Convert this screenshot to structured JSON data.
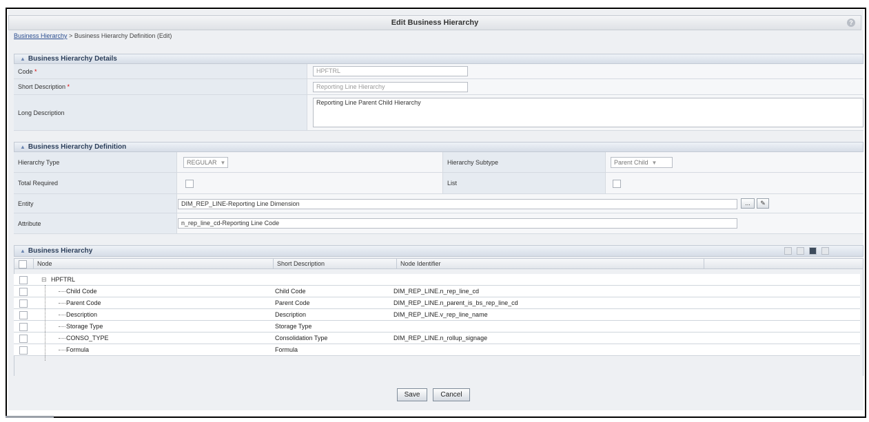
{
  "window": {
    "title": "Edit Business Hierarchy"
  },
  "breadcrumb": {
    "link": "Business Hierarchy",
    "separator": ">",
    "current": "Business Hierarchy Definition (Edit)"
  },
  "details": {
    "header": "Business Hierarchy Details",
    "code_label": "Code",
    "code_value": "HPFTRL",
    "short_desc_label": "Short Description",
    "short_desc_value": "Reporting Line Hierarchy",
    "long_desc_label": "Long Description",
    "long_desc_value": "Reporting Line Parent Child Hierarchy",
    "required_marker": "*"
  },
  "definition": {
    "header": "Business Hierarchy Definition",
    "hierarchy_type_label": "Hierarchy Type",
    "hierarchy_type_value": "REGULAR",
    "hierarchy_subtype_label": "Hierarchy Subtype",
    "hierarchy_subtype_value": "Parent Child",
    "total_required_label": "Total Required",
    "list_label": "List",
    "entity_label": "Entity",
    "entity_value": "DIM_REP_LINE-Reporting Line Dimension",
    "entity_browse": "...",
    "attribute_label": "Attribute",
    "attribute_value": "n_rep_line_cd-Reporting Line Code"
  },
  "hierarchy": {
    "header": "Business Hierarchy",
    "columns": {
      "node": "Node",
      "short_desc": "Short Description",
      "identifier": "Node Identifier"
    },
    "root": "HPFTRL",
    "rows": [
      {
        "node": "Child Code",
        "short_desc": "Child Code",
        "identifier": "DIM_REP_LINE.n_rep_line_cd"
      },
      {
        "node": "Parent Code",
        "short_desc": "Parent Code",
        "identifier": "DIM_REP_LINE.n_parent_is_bs_rep_line_cd"
      },
      {
        "node": "Description",
        "short_desc": "Description",
        "identifier": "DIM_REP_LINE.v_rep_line_name"
      },
      {
        "node": "Storage Type",
        "short_desc": "Storage Type",
        "identifier": ""
      },
      {
        "node": "CONSO_TYPE",
        "short_desc": "Consolidation Type",
        "identifier": "DIM_REP_LINE.n_rollup_signage"
      },
      {
        "node": "Formula",
        "short_desc": "Formula",
        "identifier": ""
      }
    ]
  },
  "actions": {
    "save": "Save",
    "cancel": "Cancel"
  }
}
